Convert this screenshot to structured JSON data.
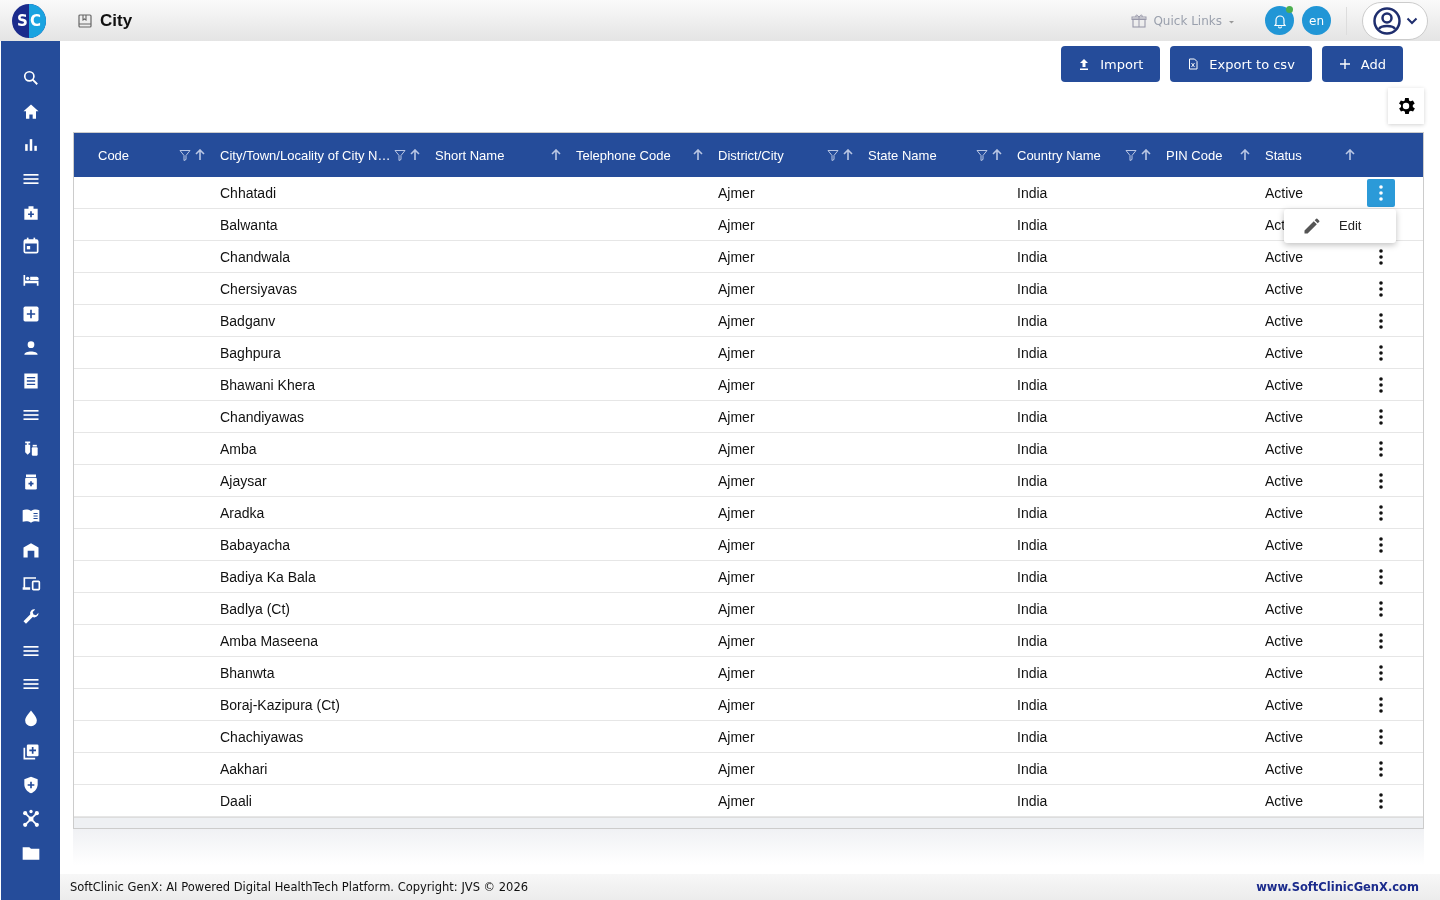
{
  "header": {
    "logo_letters": [
      "S",
      "C"
    ],
    "title": "City",
    "quick_links": "Quick Links",
    "notification_dot": true,
    "language": "en"
  },
  "sidebar": {
    "items": [
      {
        "kind": "search"
      },
      {
        "kind": "home"
      },
      {
        "kind": "chart"
      },
      {
        "kind": "menu"
      },
      {
        "kind": "bag"
      },
      {
        "kind": "calendar"
      },
      {
        "kind": "bed"
      },
      {
        "kind": "plus"
      },
      {
        "kind": "person"
      },
      {
        "kind": "receipt"
      },
      {
        "kind": "menu"
      },
      {
        "kind": "vials"
      },
      {
        "kind": "jar"
      },
      {
        "kind": "book"
      },
      {
        "kind": "building"
      },
      {
        "kind": "devices"
      },
      {
        "kind": "wrench"
      },
      {
        "kind": "menu"
      },
      {
        "kind": "menu"
      },
      {
        "kind": "drop"
      },
      {
        "kind": "library"
      },
      {
        "kind": "shield"
      },
      {
        "kind": "hub"
      },
      {
        "kind": "folder"
      }
    ]
  },
  "toolbar": {
    "buttons": [
      {
        "kind": "import",
        "label": "Import"
      },
      {
        "kind": "export",
        "label": "Export to csv"
      },
      {
        "kind": "add",
        "label": "Add"
      }
    ]
  },
  "table": {
    "columns": [
      {
        "label": "Code",
        "filter": true
      },
      {
        "label": "City/Town/Locality of City N…",
        "filter": true
      },
      {
        "label": "Short Name",
        "filter": false
      },
      {
        "label": "Telephone Code",
        "filter": false
      },
      {
        "label": "District/City",
        "filter": true
      },
      {
        "label": "State Name",
        "filter": true
      },
      {
        "label": "Country Name",
        "filter": true
      },
      {
        "label": "PIN Code",
        "filter": false
      },
      {
        "label": "Status",
        "filter": false
      }
    ],
    "rows": [
      {
        "cells": [
          "",
          "Chhatadi",
          "",
          "",
          "Ajmer",
          "",
          "India",
          "",
          "Active"
        ],
        "menu_open": true
      },
      {
        "cells": [
          "",
          "Balwanta",
          "",
          "",
          "Ajmer",
          "",
          "India",
          "",
          "Act"
        ],
        "menu_open": false
      },
      {
        "cells": [
          "",
          "Chandwala",
          "",
          "",
          "Ajmer",
          "",
          "India",
          "",
          "Active"
        ],
        "menu_open": false
      },
      {
        "cells": [
          "",
          "Chersiyavas",
          "",
          "",
          "Ajmer",
          "",
          "India",
          "",
          "Active"
        ],
        "menu_open": false
      },
      {
        "cells": [
          "",
          "Badganv",
          "",
          "",
          "Ajmer",
          "",
          "India",
          "",
          "Active"
        ],
        "menu_open": false
      },
      {
        "cells": [
          "",
          "Baghpura",
          "",
          "",
          "Ajmer",
          "",
          "India",
          "",
          "Active"
        ],
        "menu_open": false
      },
      {
        "cells": [
          "",
          "Bhawani Khera",
          "",
          "",
          "Ajmer",
          "",
          "India",
          "",
          "Active"
        ],
        "menu_open": false
      },
      {
        "cells": [
          "",
          "Chandiyawas",
          "",
          "",
          "Ajmer",
          "",
          "India",
          "",
          "Active"
        ],
        "menu_open": false
      },
      {
        "cells": [
          "",
          "Amba",
          "",
          "",
          "Ajmer",
          "",
          "India",
          "",
          "Active"
        ],
        "menu_open": false
      },
      {
        "cells": [
          "",
          "Ajaysar",
          "",
          "",
          "Ajmer",
          "",
          "India",
          "",
          "Active"
        ],
        "menu_open": false
      },
      {
        "cells": [
          "",
          "Aradka",
          "",
          "",
          "Ajmer",
          "",
          "India",
          "",
          "Active"
        ],
        "menu_open": false
      },
      {
        "cells": [
          "",
          "Babayacha",
          "",
          "",
          "Ajmer",
          "",
          "India",
          "",
          "Active"
        ],
        "menu_open": false
      },
      {
        "cells": [
          "",
          "Badiya Ka Bala",
          "",
          "",
          "Ajmer",
          "",
          "India",
          "",
          "Active"
        ],
        "menu_open": false
      },
      {
        "cells": [
          "",
          "Badlya (Ct)",
          "",
          "",
          "Ajmer",
          "",
          "India",
          "",
          "Active"
        ],
        "menu_open": false
      },
      {
        "cells": [
          "",
          "Amba Maseena",
          "",
          "",
          "Ajmer",
          "",
          "India",
          "",
          "Active"
        ],
        "menu_open": false
      },
      {
        "cells": [
          "",
          "Bhanwta",
          "",
          "",
          "Ajmer",
          "",
          "India",
          "",
          "Active"
        ],
        "menu_open": false
      },
      {
        "cells": [
          "",
          "Boraj-Kazipura (Ct)",
          "",
          "",
          "Ajmer",
          "",
          "India",
          "",
          "Active"
        ],
        "menu_open": false
      },
      {
        "cells": [
          "",
          "Chachiyawas",
          "",
          "",
          "Ajmer",
          "",
          "India",
          "",
          "Active"
        ],
        "menu_open": false
      },
      {
        "cells": [
          "",
          "Aakhari",
          "",
          "",
          "Ajmer",
          "",
          "India",
          "",
          "Active"
        ],
        "menu_open": false
      },
      {
        "cells": [
          "",
          "Daali",
          "",
          "",
          "Ajmer",
          "",
          "India",
          "",
          "Active"
        ],
        "menu_open": false
      }
    ],
    "row_menu": {
      "items": [
        {
          "label": "Edit"
        }
      ]
    }
  },
  "footer": {
    "copyright": "SoftClinic GenX: AI Powered Digital HealthTech Platform. Copyright: JVS © 2026",
    "website": "www.SoftClinicGenX.com"
  }
}
